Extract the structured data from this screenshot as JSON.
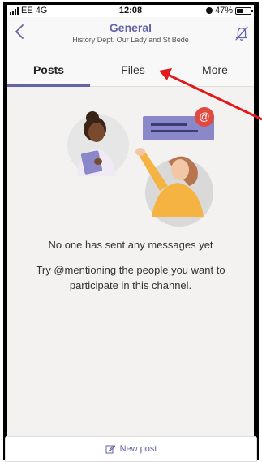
{
  "status_bar": {
    "carrier": "EE",
    "network": "4G",
    "time": "12:08",
    "battery_percent": "47%"
  },
  "header": {
    "title": "General",
    "subtitle": "History Dept. Our Lady and St Bede"
  },
  "tabs": [
    {
      "label": "Posts",
      "active": true
    },
    {
      "label": "Files",
      "active": false
    },
    {
      "label": "More",
      "active": false
    }
  ],
  "empty_state": {
    "title": "No one has sent any messages yet",
    "subtitle": "Try @mentioning the people you want to participate in this channel."
  },
  "composer": {
    "new_post_label": "New post"
  },
  "colors": {
    "accent": "#6264a7",
    "annotation_arrow": "#e0191b",
    "mention_badge": "#e04b3f"
  },
  "icons": [
    "signal-icon",
    "alarm-icon",
    "battery-icon",
    "back-chevron-icon",
    "bell-off-icon",
    "compose-icon",
    "mention-icon"
  ]
}
